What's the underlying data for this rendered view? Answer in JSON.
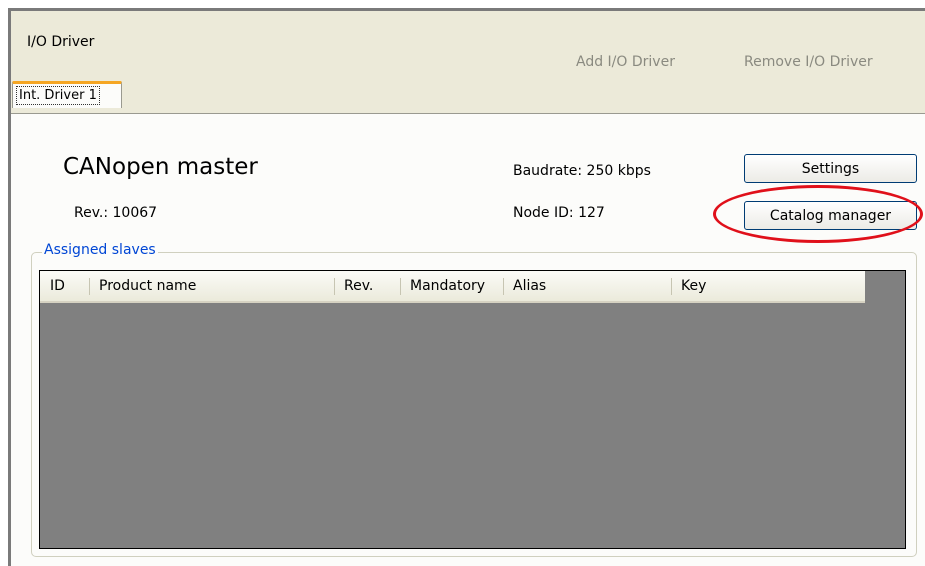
{
  "header": {
    "title": "I/O Driver",
    "add_label": "Add I/O Driver",
    "remove_label": "Remove I/O Driver"
  },
  "tabs": [
    {
      "label": "Int. Driver 1",
      "selected": true
    }
  ],
  "device": {
    "name": "CANopen master",
    "revision": "Rev.: 10067",
    "baudrate": "Baudrate: 250 kbps",
    "node_id": "Node ID: 127"
  },
  "buttons": {
    "settings": "Settings",
    "catalog_manager": "Catalog manager"
  },
  "slaves": {
    "group_label": "Assigned slaves",
    "columns": [
      "ID",
      "Product name",
      "Rev.",
      "Mandatory",
      "Alias",
      "Key"
    ],
    "rows": []
  },
  "colors": {
    "highlight": "#e0101a",
    "group_label": "#0046d5",
    "tab_accent": "#f5a623",
    "list_background": "#808080"
  }
}
